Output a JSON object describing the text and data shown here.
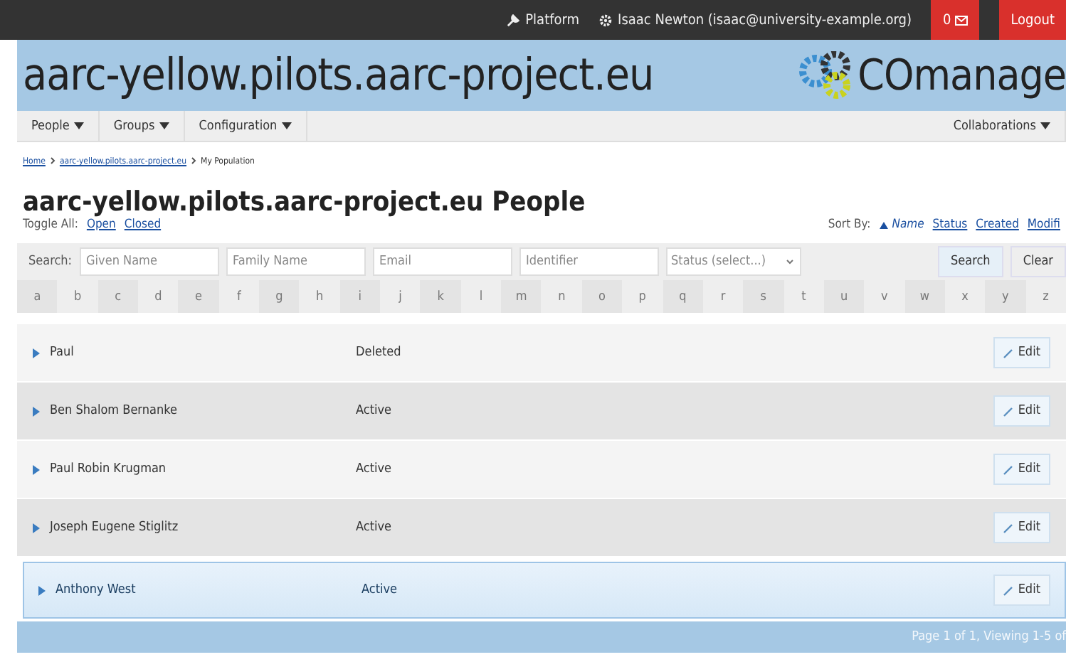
{
  "topbar": {
    "platform": "Platform",
    "user": "Isaac Newton (isaac@university-example.org)",
    "notifications": "0",
    "logout": "Logout"
  },
  "header": {
    "title": "aarc-yellow.pilots.aarc-project.eu",
    "logo_text": "COmanage"
  },
  "menu": [
    {
      "label": "People"
    },
    {
      "label": "Groups"
    },
    {
      "label": "Configuration"
    }
  ],
  "menu_right": {
    "label": "Collaborations"
  },
  "breadcrumbs": [
    {
      "label": "Home",
      "link": true
    },
    {
      "label": "aarc-yellow.pilots.aarc-project.eu",
      "link": true
    },
    {
      "label": "My Population",
      "link": false
    }
  ],
  "page_title": "aarc-yellow.pilots.aarc-project.eu People",
  "toggle": {
    "label": "Toggle All:",
    "options": [
      "Open",
      "Closed"
    ]
  },
  "sort": {
    "label": "Sort By:",
    "options": [
      {
        "label": "Name",
        "selected": true
      },
      {
        "label": "Status",
        "selected": false
      },
      {
        "label": "Created",
        "selected": false
      },
      {
        "label": "Modifi",
        "selected": false
      }
    ]
  },
  "search": {
    "label": "Search:",
    "fields": [
      {
        "placeholder": "Given Name"
      },
      {
        "placeholder": "Family Name"
      },
      {
        "placeholder": "Email"
      },
      {
        "placeholder": "Identifier"
      }
    ],
    "status_placeholder": "Status (select...)",
    "buttons": [
      "Search",
      "Clear"
    ]
  },
  "letters": [
    "a",
    "b",
    "c",
    "d",
    "e",
    "f",
    "g",
    "h",
    "i",
    "j",
    "k",
    "l",
    "m",
    "n",
    "o",
    "p",
    "q",
    "r",
    "s",
    "t",
    "u",
    "v",
    "w",
    "x",
    "y",
    "z"
  ],
  "people": [
    {
      "name": "Paul",
      "status": "Deleted",
      "selected": false,
      "edit": "Edit"
    },
    {
      "name": "Ben Shalom Bernanke",
      "status": "Active",
      "selected": false,
      "edit": "Edit"
    },
    {
      "name": "Paul Robin Krugman",
      "status": "Active",
      "selected": false,
      "edit": "Edit"
    },
    {
      "name": "Joseph Eugene Stiglitz",
      "status": "Active",
      "selected": false,
      "edit": "Edit"
    },
    {
      "name": "Anthony West",
      "status": "Active",
      "selected": true,
      "edit": "Edit"
    }
  ],
  "pagination": "Page 1 of 1, Viewing 1-5 of"
}
